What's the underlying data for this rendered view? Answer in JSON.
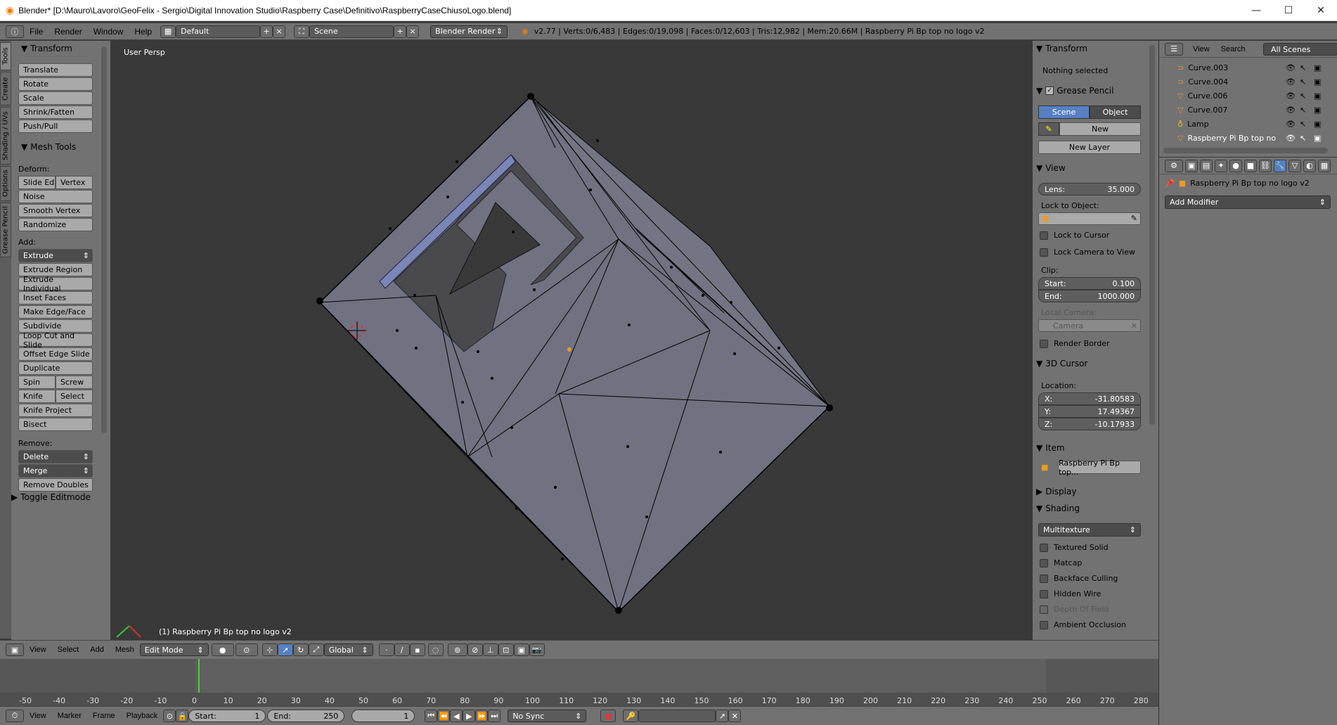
{
  "window": {
    "title": "Blender* [D:\\Mauro\\Lavoro\\GeoFelix - Sergio\\Digital Innovation Studio\\Raspberry Case\\Definitivo\\RaspberryCaseChiusoLogo.blend]",
    "minimize": "—",
    "maximize": "☐",
    "close": "✕"
  },
  "info": {
    "menus": [
      "File",
      "Render",
      "Window",
      "Help"
    ],
    "layout": "Default",
    "scene": "Scene",
    "engine": "Blender Render",
    "stats": "v2.77 | Verts:0/6,483 | Edges:0/19,098 | Faces:0/12,603 | Tris:12,982 | Mem:20.66M | Raspberry Pi Bp top no logo v2"
  },
  "left_tabs": [
    "Tools",
    "Create",
    "Shading / UVs",
    "Options",
    "Grease Pencil"
  ],
  "tools": {
    "transform_header": "Transform",
    "transform_buttons": [
      "Translate",
      "Rotate",
      "Scale",
      "Shrink/Fatten",
      "Push/Pull"
    ],
    "mesh_tools_header": "Mesh Tools",
    "deform_label": "Deform:",
    "slide_edge": "Slide Ed",
    "vertex": "Vertex",
    "deform_buttons": [
      "Noise",
      "Smooth Vertex",
      "Randomize"
    ],
    "add_label": "Add:",
    "extrude": "Extrude",
    "add_buttons": [
      "Extrude Region",
      "Extrude Individual",
      "Inset Faces",
      "Make Edge/Face",
      "Subdivide",
      "Loop Cut and Slide",
      "Offset Edge Slide",
      "Duplicate"
    ],
    "spin": "Spin",
    "screw": "Screw",
    "knife": "Knife",
    "select": "Select",
    "knife_project": "Knife Project",
    "bisect": "Bisect",
    "remove_label": "Remove:",
    "delete": "Delete",
    "merge": "Merge",
    "remove_doubles": "Remove Doubles",
    "toggle_editmode": "Toggle Editmode"
  },
  "viewport": {
    "view_name": "User Persp",
    "object_label": "(1) Raspberry Pi Bp top no logo v2"
  },
  "props": {
    "transform": "Transform",
    "nothing_selected": "Nothing selected",
    "grease_pencil": "Grease Pencil",
    "scene_btn": "Scene",
    "object_btn": "Object",
    "new_btn": "New",
    "new_layer": "New Layer",
    "view": "View",
    "lens_label": "Lens:",
    "lens_value": "35.000",
    "lock_to_object": "Lock to Object:",
    "lock_to_cursor": "Lock to Cursor",
    "lock_camera": "Lock Camera to View",
    "clip": "Clip:",
    "start_label": "Start:",
    "start_value": "0.100",
    "end_label": "End:",
    "end_value": "1000.000",
    "local_camera": "Local Camera:",
    "camera": "Camera",
    "render_border": "Render Border",
    "cursor_3d": "3D Cursor",
    "location": "Location:",
    "x_label": "X:",
    "x_value": "-31.80583",
    "y_label": "Y:",
    "y_value": "17.49367",
    "z_label": "Z:",
    "z_value": "-10.17933",
    "item": "Item",
    "item_name": "Raspberry Pi Bp top...",
    "display": "Display",
    "shading": "Shading",
    "shading_mode": "Multitexture",
    "shading_checks": [
      "Textured Solid",
      "Matcap",
      "Backface Culling",
      "Hidden Wire",
      "Depth Of Field",
      "Ambient Occlusion"
    ]
  },
  "outliner": {
    "view": "View",
    "search": "Search",
    "all_scenes": "All Scenes",
    "items": [
      "Curve.003",
      "Curve.004",
      "Curve.006",
      "Curve.007",
      "Lamp",
      "Raspberry Pi Bp top no"
    ]
  },
  "properties": {
    "object_name": "Raspberry Pi Bp top no logo v2",
    "add_modifier": "Add Modifier"
  },
  "view3d_header": {
    "menus": [
      "View",
      "Select",
      "Add",
      "Mesh"
    ],
    "mode": "Edit Mode",
    "orientation": "Global"
  },
  "timeline": {
    "ticks": [
      "-50",
      "-40",
      "-30",
      "-20",
      "-10",
      "0",
      "10",
      "20",
      "30",
      "40",
      "50",
      "60",
      "70",
      "80",
      "90",
      "100",
      "110",
      "120",
      "130",
      "140",
      "150",
      "160",
      "170",
      "180",
      "190",
      "200",
      "210",
      "220",
      "230",
      "240",
      "250",
      "260",
      "270",
      "280"
    ],
    "menus": [
      "View",
      "Marker",
      "Frame",
      "Playback"
    ],
    "start_label": "Start:",
    "start_value": "1",
    "end_label": "End:",
    "end_value": "250",
    "current": "1",
    "sync": "No Sync"
  }
}
